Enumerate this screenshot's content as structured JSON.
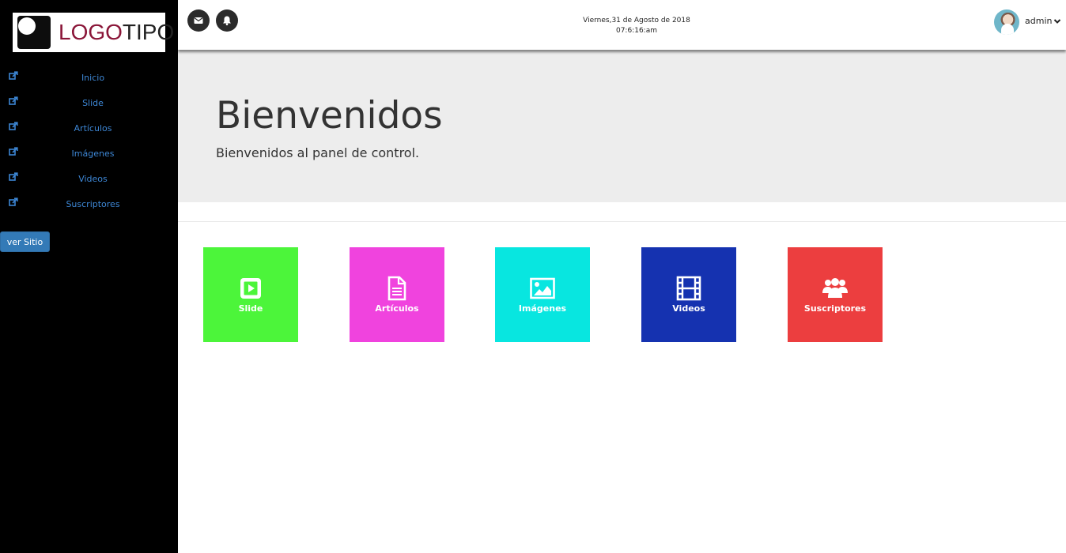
{
  "brand": {
    "logo_part1": "LOGO",
    "logo_part2": "TIPO"
  },
  "sidebar": {
    "items": [
      {
        "label": "Inicio",
        "icon": "external-link-icon"
      },
      {
        "label": "Slide",
        "icon": "external-link-icon"
      },
      {
        "label": "Artículos",
        "icon": "external-link-icon"
      },
      {
        "label": "Imágenes",
        "icon": "external-link-icon"
      },
      {
        "label": "Videos",
        "icon": "external-link-icon"
      },
      {
        "label": "Suscriptores",
        "icon": "external-link-icon"
      }
    ],
    "site_button": "ver Sitio"
  },
  "topbar": {
    "date": "Viernes,31 de Agosto de 2018",
    "time": "07:6:16:am",
    "user_name": "admin",
    "icons": [
      "envelope-icon",
      "bell-icon",
      "chevron-down-icon"
    ]
  },
  "hero": {
    "title": "Bienvenidos",
    "subtitle": "Bienvenidos al panel de control."
  },
  "tiles": [
    {
      "label": "Slide",
      "icon": "play-square-icon",
      "color": "#4cf53a"
    },
    {
      "label": "Artículos",
      "icon": "file-text-icon",
      "color": "#f043de"
    },
    {
      "label": "Imágenes",
      "icon": "image-icon",
      "color": "#08e6e0"
    },
    {
      "label": "Videos",
      "icon": "film-icon",
      "color": "#1532b0"
    },
    {
      "label": "Suscriptores",
      "icon": "users-icon",
      "color": "#ec3e3f"
    }
  ],
  "colors": {
    "sidebar_bg": "#000000",
    "link": "#3d86d4",
    "button": "#337ab7",
    "hero_bg": "#ededed"
  }
}
